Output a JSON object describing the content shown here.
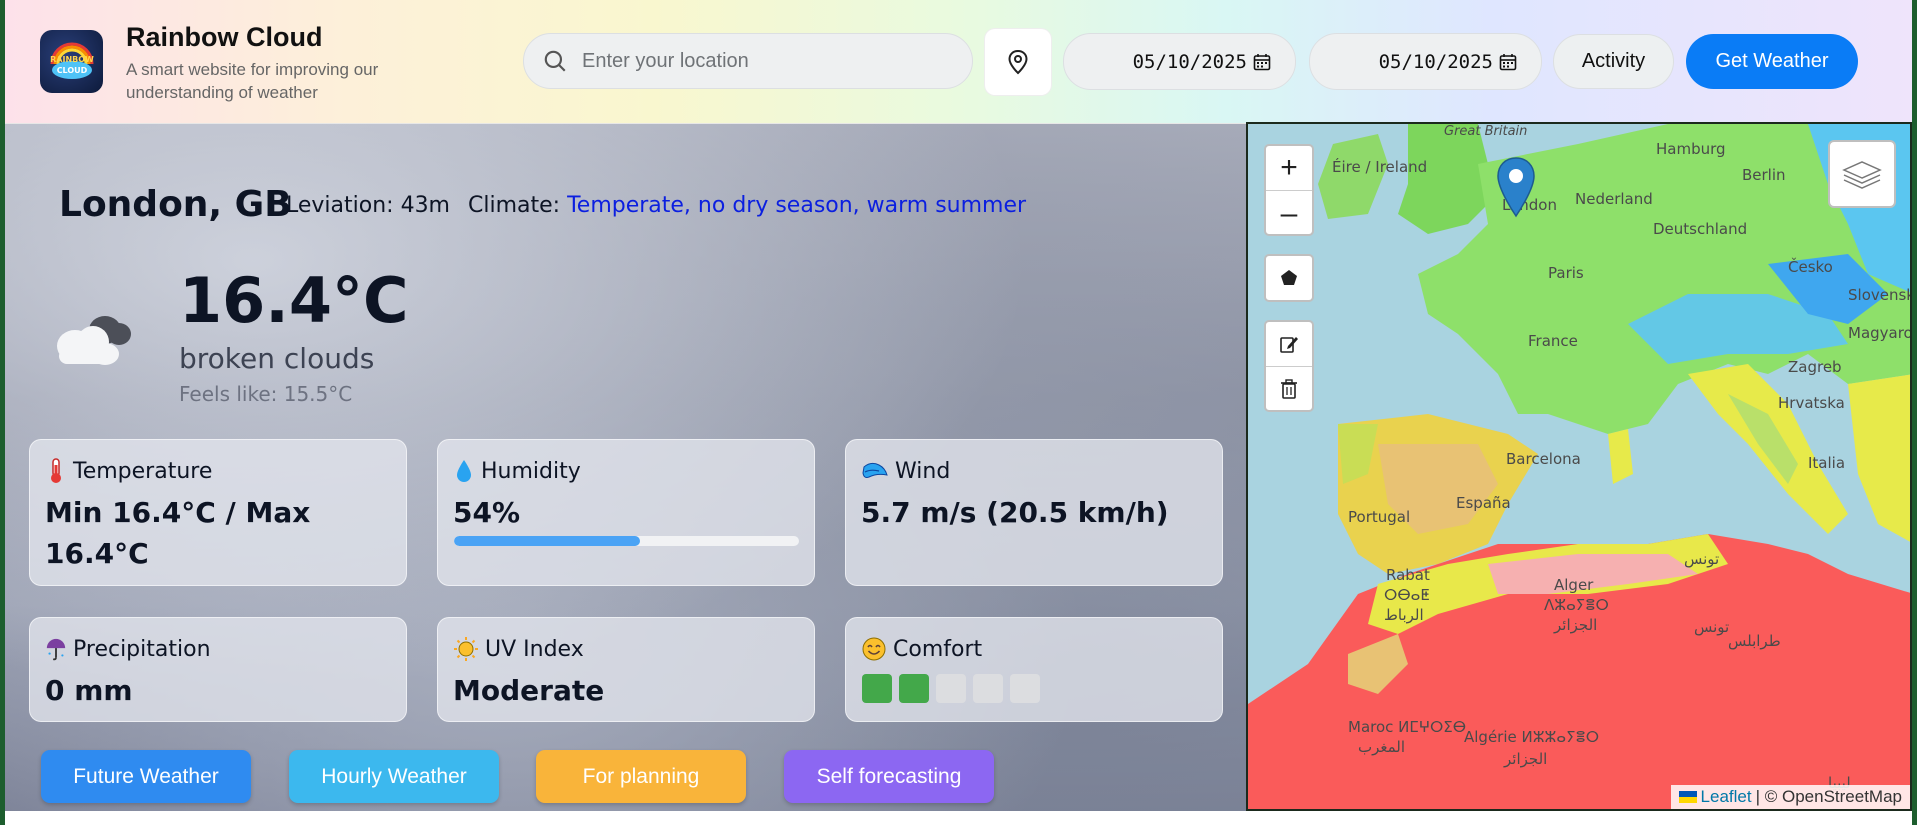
{
  "header": {
    "title": "Rainbow Cloud",
    "subtitle": "A smart website for improving our understanding of weather",
    "logo_text": "RAINBOW CLOUD",
    "search_placeholder": "Enter your location",
    "start_date": "05/10/2025",
    "end_date": "05/10/2025",
    "activity_label": "Activity",
    "get_weather_label": "Get Weather"
  },
  "location": {
    "city": "London, GB",
    "elevation": "Leviation: 43m",
    "climate_label": "Climate:",
    "climate_value": "Temperate, no dry season, warm summer"
  },
  "current": {
    "temperature": "16.4°C",
    "description": "broken clouds",
    "feels_like": "Feels like: 15.5°C",
    "icon": "cloud-icon"
  },
  "cards": {
    "temperature": {
      "label": "Temperature",
      "value": "Min 16.4°C / Max 16.4°C",
      "icon": "thermometer-icon"
    },
    "humidity": {
      "label": "Humidity",
      "value": "54%",
      "percent": 54,
      "icon": "droplet-icon"
    },
    "wind": {
      "label": "Wind",
      "value": "5.7 m/s (20.5 km/h)",
      "icon": "wind-icon"
    },
    "precipitation": {
      "label": "Precipitation",
      "value": "0 mm",
      "icon": "umbrella-icon"
    },
    "uv": {
      "label": "UV Index",
      "value": "Moderate",
      "icon": "sun-icon"
    },
    "comfort": {
      "label": "Comfort",
      "level": 2,
      "max": 5,
      "icon": "smile-icon"
    }
  },
  "nav_buttons": [
    {
      "label": "Future Weather",
      "color": "#2f8bf0"
    },
    {
      "label": "Hourly Weather",
      "color": "#3cb8ee"
    },
    {
      "label": "For planning",
      "color": "#f9b43a"
    },
    {
      "label": "Self forecasting",
      "color": "#8c67f2"
    }
  ],
  "map": {
    "labels": {
      "great_britain": "Great Britain",
      "ireland": "Éire / Ireland",
      "hamburg": "Hamburg",
      "berlin": "Berlin",
      "nederland": "Nederland",
      "deutschland": "Deutschland",
      "london": "London",
      "paris": "Paris",
      "cesko": "Česko",
      "slovensko": "Slovensko",
      "magyarorszag": "Magyarország",
      "france": "France",
      "zagreb": "Zagreb",
      "hrvatska": "Hrvatska",
      "italia": "Italia",
      "barcelona": "Barcelona",
      "espana": "España",
      "portugal": "Portugal",
      "rabat": "Rabat",
      "rabat_tifinagh": "ⵔⴱⴰⵟ",
      "rabat_ar": "الرباط",
      "alger": "Alger",
      "alger_tifinagh": "ⴷⵣⴰⵢⴻⵔ",
      "alger_ar": "الجزائر",
      "tunis_ar": "تونس",
      "tunis_ar2": "تونس",
      "tarabulus": "طرابلس",
      "maroc": "Maroc ⵍⵎⵖⵔⵉⴱ",
      "maroc_ar": "المغرب",
      "algerie": "Algérie ⵍⵣⵣⴰⵢⴻⵔ",
      "algerie_ar": "الجزائر",
      "libya_ar": "ليبيا"
    },
    "zoom_in": "+",
    "zoom_out": "–",
    "attribution_link": "Leaflet",
    "attribution_text": "| © OpenStreetMap"
  }
}
